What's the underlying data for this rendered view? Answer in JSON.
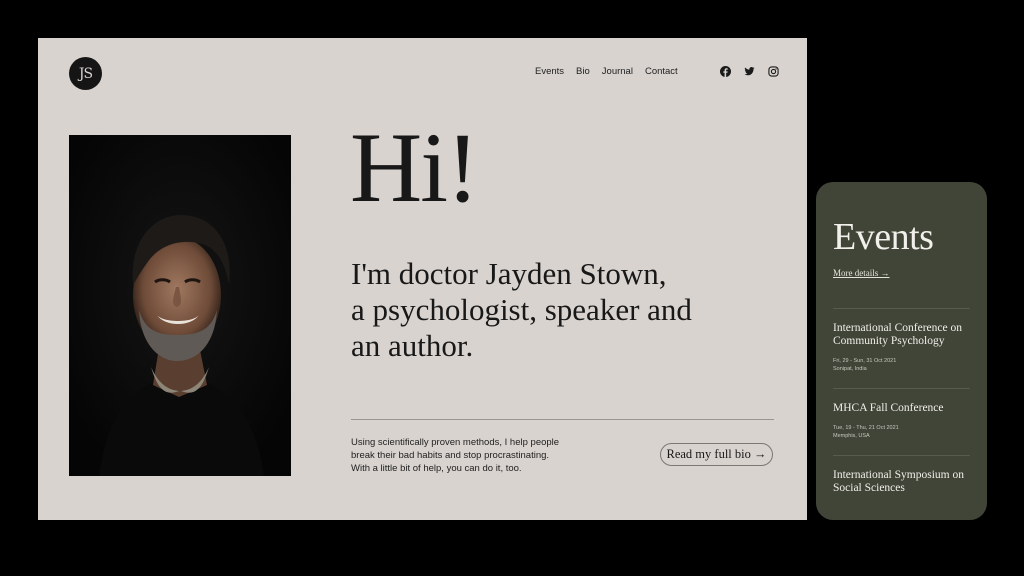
{
  "site": {
    "logo_text": "JS",
    "nav": [
      "Events",
      "Bio",
      "Journal",
      "Contact"
    ],
    "social_icons": [
      "facebook-icon",
      "twitter-icon",
      "instagram-icon"
    ],
    "hero": {
      "greeting": "Hi!",
      "intro_lines": [
        "I'm doctor Jayden Stown,",
        "a psychologist, speaker and",
        "an author."
      ]
    },
    "description_lines": [
      "Using scientifically proven methods, I help people",
      "break their bad habits and stop procrastinating.",
      "With a little bit of help, you can do it, too."
    ],
    "bio_button": "Read my full bio →"
  },
  "events": {
    "title": "Events",
    "more_link": "More details →",
    "items": [
      {
        "name_lines": [
          "International Conference on",
          "Community Psychology"
        ],
        "date": "Fri, 29 - Sun, 31 Oct 2021",
        "location": "Sonipat, India"
      },
      {
        "name_lines": [
          "MHCA Fall Conference"
        ],
        "date": "Tue, 19 - Thu, 21 Oct 2021",
        "location": "Memphis, USA"
      },
      {
        "name_lines": [
          "International Symposium on",
          "Social Sciences"
        ]
      }
    ]
  },
  "colors": {
    "page_bg": "#000000",
    "site_bg": "#d8d3cf",
    "text": "#181818",
    "events_bg": "#404538",
    "events_text": "#ecebe4"
  }
}
